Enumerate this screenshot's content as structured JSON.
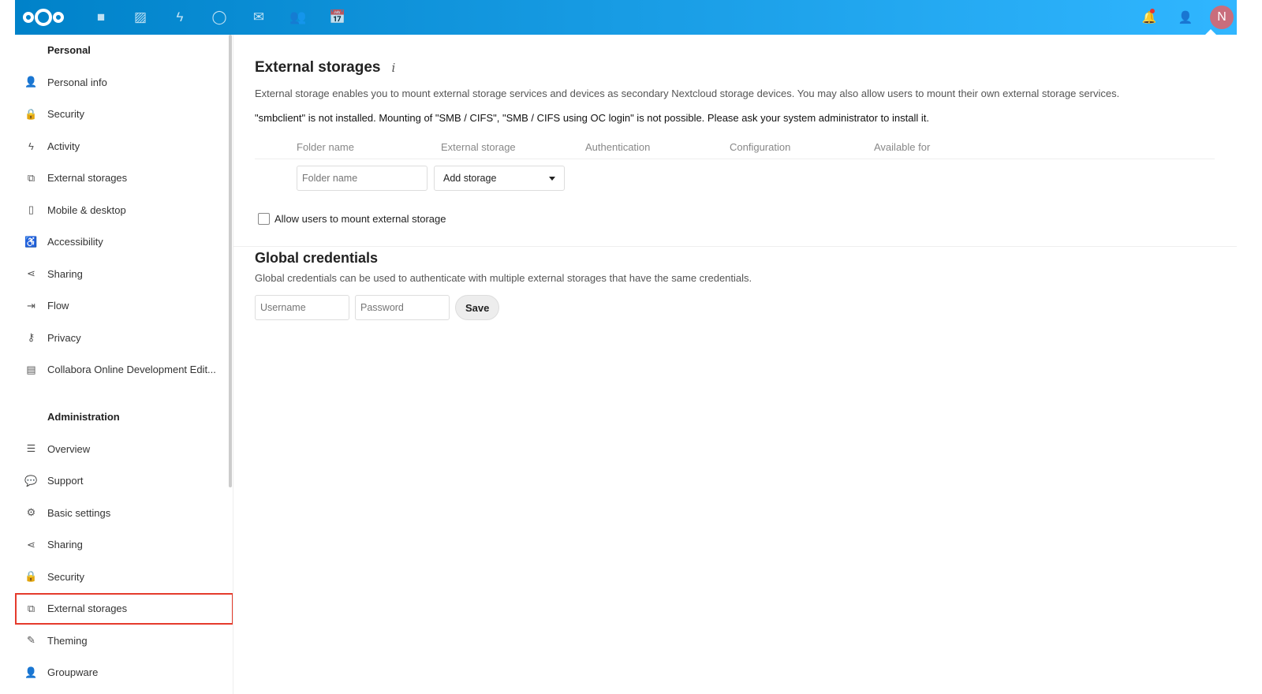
{
  "header": {
    "apps": [
      {
        "icon": "folder-icon",
        "glyph": "■",
        "name": "files"
      },
      {
        "icon": "image-icon",
        "glyph": "▨",
        "name": "photos"
      },
      {
        "icon": "lightning-icon",
        "glyph": "ϟ",
        "name": "activity"
      },
      {
        "icon": "search-circle-icon",
        "glyph": "◯",
        "name": "talk"
      },
      {
        "icon": "mail-icon",
        "glyph": "✉",
        "name": "mail"
      },
      {
        "icon": "contacts-icon",
        "glyph": "👥",
        "name": "contacts"
      },
      {
        "icon": "calendar-icon",
        "glyph": "📅",
        "name": "calendar"
      }
    ],
    "avatar_letter": "N",
    "accent": "#0082c9"
  },
  "sidebar": {
    "personal_title": "Personal",
    "personal": [
      {
        "label": "Personal info",
        "icon": "person-icon",
        "glyph": "👤"
      },
      {
        "label": "Security",
        "icon": "lock-icon",
        "glyph": "🔒"
      },
      {
        "label": "Activity",
        "icon": "lightning-icon",
        "glyph": "ϟ"
      },
      {
        "label": "External storages",
        "icon": "external-link-icon",
        "glyph": "⧉"
      },
      {
        "label": "Mobile & desktop",
        "icon": "phone-icon",
        "glyph": "▯"
      },
      {
        "label": "Accessibility",
        "icon": "accessibility-icon",
        "glyph": "♿"
      },
      {
        "label": "Sharing",
        "icon": "share-icon",
        "glyph": "⋖"
      },
      {
        "label": "Flow",
        "icon": "flow-icon",
        "glyph": "⇥"
      },
      {
        "label": "Privacy",
        "icon": "key-icon",
        "glyph": "⚷"
      },
      {
        "label": "Collabora Online Development Edit...",
        "icon": "document-icon",
        "glyph": "▤"
      }
    ],
    "admin_title": "Administration",
    "admin": [
      {
        "label": "Overview",
        "icon": "list-icon",
        "glyph": "☰"
      },
      {
        "label": "Support",
        "icon": "speech-bubble-icon",
        "glyph": "💬"
      },
      {
        "label": "Basic settings",
        "icon": "gear-icon",
        "glyph": "⚙"
      },
      {
        "label": "Sharing",
        "icon": "share-icon",
        "glyph": "⋖"
      },
      {
        "label": "Security",
        "icon": "lock-icon",
        "glyph": "🔒"
      },
      {
        "label": "External storages",
        "icon": "external-link-icon",
        "glyph": "⧉"
      },
      {
        "label": "Theming",
        "icon": "brush-icon",
        "glyph": "✎"
      },
      {
        "label": "Groupware",
        "icon": "groupware-icon",
        "glyph": "👤"
      }
    ]
  },
  "main": {
    "title": "External storages",
    "description": "External storage enables you to mount external storage services and devices as secondary Nextcloud storage devices. You may also allow users to mount their own external storage services.",
    "warning": "\"smbclient\" is not installed. Mounting of \"SMB / CIFS\", \"SMB / CIFS using OC login\" is not possible. Please ask your system administrator to install it.",
    "columns": [
      "Folder name",
      "External storage",
      "Authentication",
      "Configuration",
      "Available for"
    ],
    "folder_placeholder": "Folder name",
    "add_storage": "Add storage",
    "allow_users_label": "Allow users to mount external storage",
    "credentials_title": "Global credentials",
    "credentials_desc": "Global credentials can be used to authenticate with multiple external storages that have the same credentials.",
    "username_placeholder": "Username",
    "password_placeholder": "Password",
    "save_label": "Save"
  }
}
